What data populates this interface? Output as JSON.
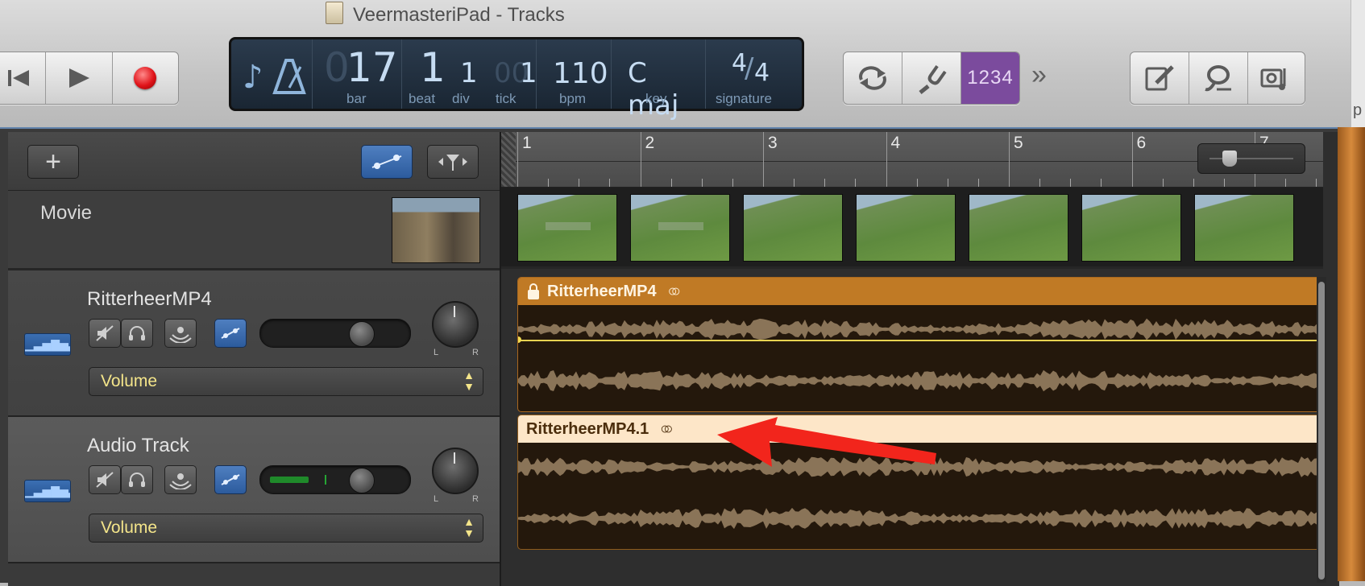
{
  "window": {
    "title": "VeermasteriPad - Tracks"
  },
  "transport": {
    "rewind_icon": "rewind-icon",
    "play_icon": "play-icon",
    "record_icon": "record-icon"
  },
  "lcd": {
    "bar": "17",
    "bar_dim": "0",
    "bar_label": "bar",
    "beat": "1",
    "beat_label": "beat",
    "div": "1",
    "div_label": "div",
    "tick": "1",
    "tick_dim": "00",
    "tick_label": "tick",
    "bpm": "110",
    "bpm_label": "bpm",
    "key": "C maj",
    "key_label": "key",
    "signature_top": "4",
    "signature_bottom": "4",
    "signature_label": "signature"
  },
  "toolbar": {
    "count_in": "1234",
    "more": "»"
  },
  "track_area": {
    "add_track": "+",
    "ruler_bars": [
      "1",
      "2",
      "3",
      "4",
      "5",
      "6",
      "7"
    ]
  },
  "movie_track": {
    "label": "Movie"
  },
  "tracks": [
    {
      "name": "RitterheerMP4",
      "automation": "Volume",
      "pan_left": "L",
      "pan_right": "R",
      "region_name": "RitterheerMP4"
    },
    {
      "name": "Audio Track",
      "automation": "Volume",
      "pan_left": "L",
      "pan_right": "R",
      "region_name": "RitterheerMP4.1"
    }
  ],
  "colors": {
    "accent_blue": "#6183ac",
    "region_orange": "#c07a25",
    "region_selected": "#fde6c8",
    "count_in_purple": "#7b4b9d",
    "annotation_red": "#f2251c"
  }
}
